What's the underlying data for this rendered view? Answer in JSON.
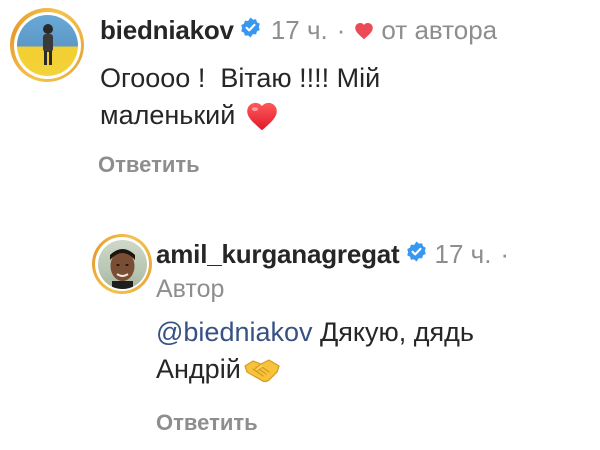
{
  "comment": {
    "username": "biedniakov",
    "time": "17 ч.",
    "separator": "·",
    "liked_by_author_label": "от автора",
    "text_line1": "Огоооо !  Вітаю !!!! Мій",
    "text_line2": "маленький",
    "heart_emoji": "❤️",
    "reply_label": "Ответить"
  },
  "reply": {
    "username": "amil_kurganagregat",
    "time": "17 ч.",
    "separator": "·",
    "author_badge": "Автор",
    "mention": "@biedniakov",
    "text_line1_rest": " Дякую, дядь",
    "text_line2": "Андрій",
    "handshake_emoji": "🤝",
    "reply_label": "Ответить"
  },
  "colors": {
    "text": "#262626",
    "secondary": "#8e8e8e",
    "verified_blue": "#3897f0",
    "heart_red": "#ed4956",
    "mention_blue": "#385185",
    "avatar_ring": "#f5c24a"
  },
  "icons": [
    "verified-badge-icon",
    "heart-icon"
  ]
}
